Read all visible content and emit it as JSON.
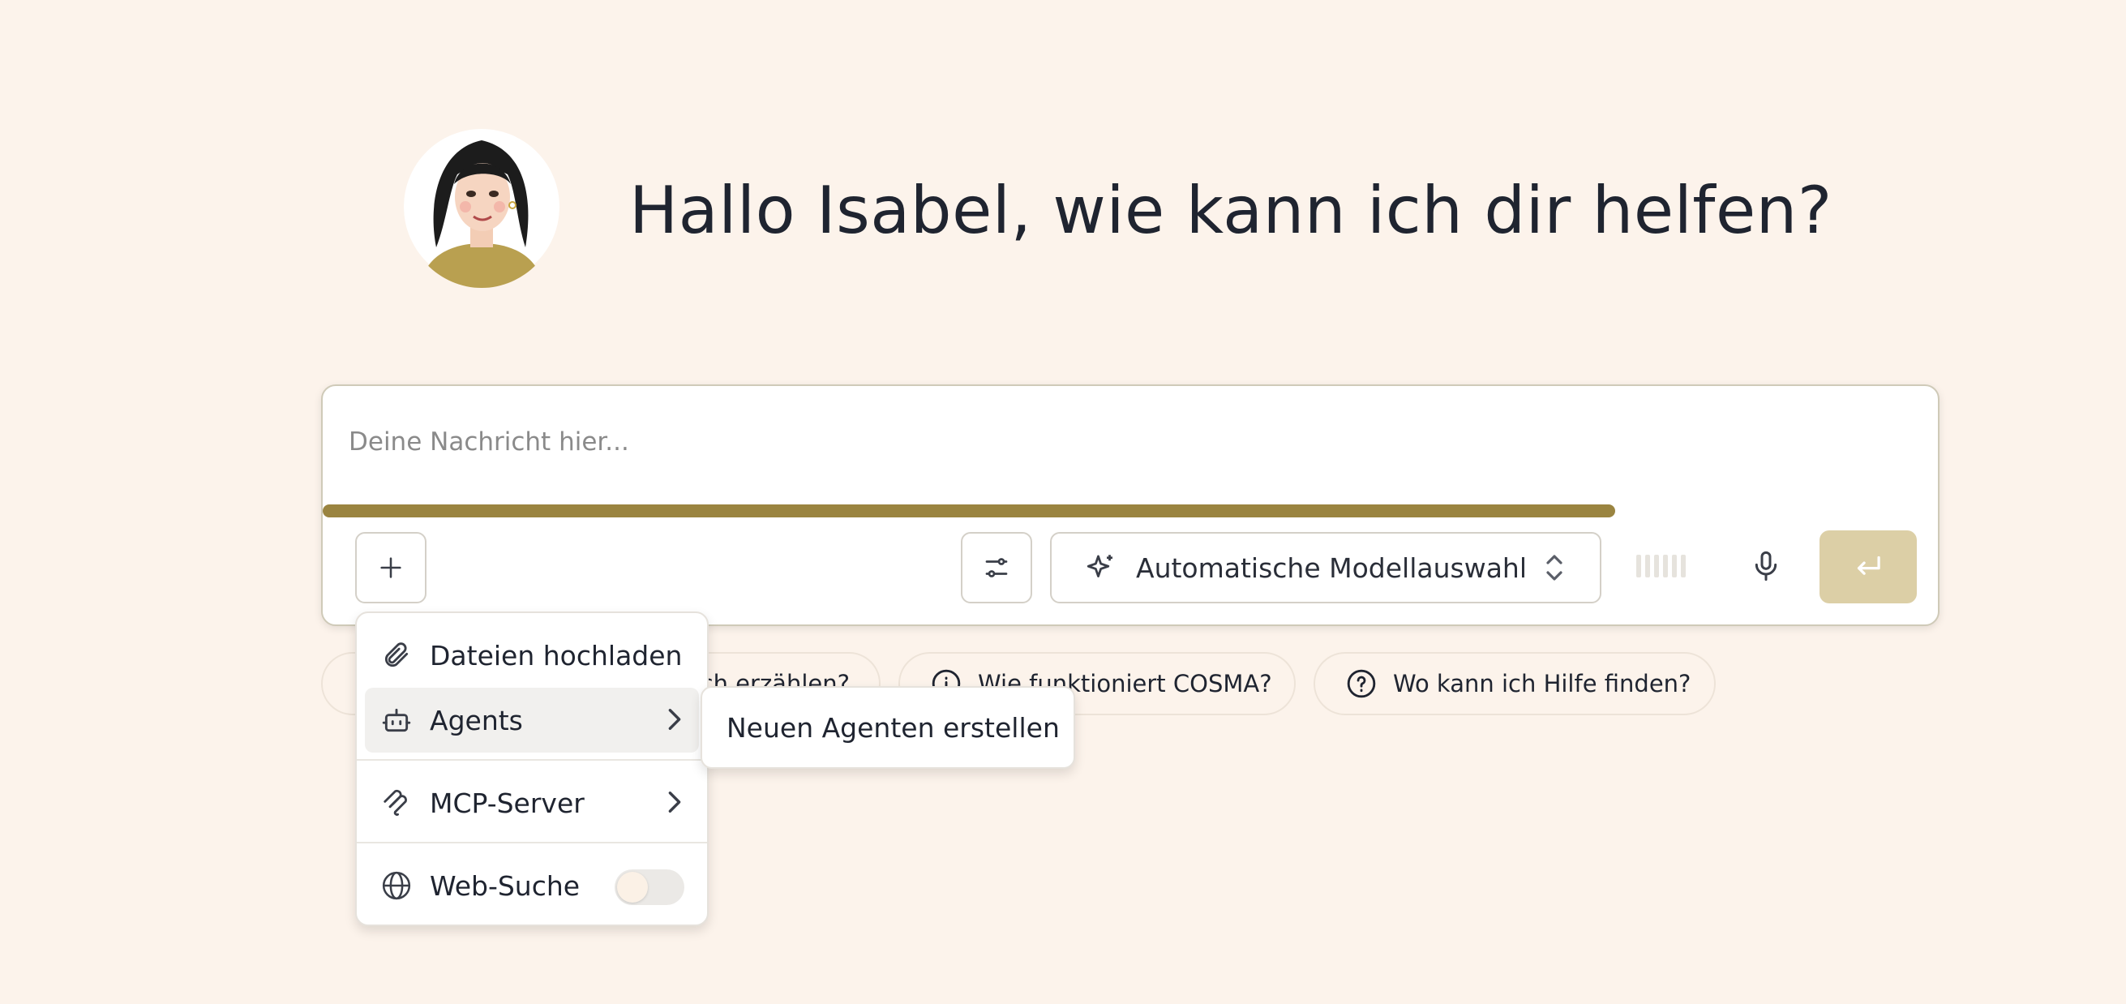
{
  "greeting": "Hallo Isabel, wie kann ich dir helfen?",
  "composer": {
    "placeholder": "Deine Nachricht hier...",
    "upload_progress": 0.8,
    "model_select_label": "Automatische Modellauswahl"
  },
  "suggestions": [
    {
      "label": "ch erzählen?",
      "icon": "none"
    },
    {
      "label": "Wie funktioniert COSMA?",
      "icon": "info-icon"
    },
    {
      "label": "Wo kann ich Hilfe finden?",
      "icon": "question-icon"
    }
  ],
  "menu": {
    "items": [
      {
        "label": "Dateien hochladen",
        "icon": "paperclip-icon"
      },
      {
        "label": "Agents",
        "icon": "bot-icon",
        "has_submenu": true
      },
      {
        "label": "MCP-Server",
        "icon": "mcp-icon",
        "has_submenu": true
      },
      {
        "label": "Web-Suche",
        "icon": "globe-icon",
        "toggle": false
      }
    ]
  },
  "submenu": {
    "items": [
      {
        "label": "Neuen Agenten erstellen"
      }
    ]
  },
  "colors": {
    "background": "#fcf3eb",
    "accent": "#9a8440",
    "send_button": "#dccfa6"
  }
}
